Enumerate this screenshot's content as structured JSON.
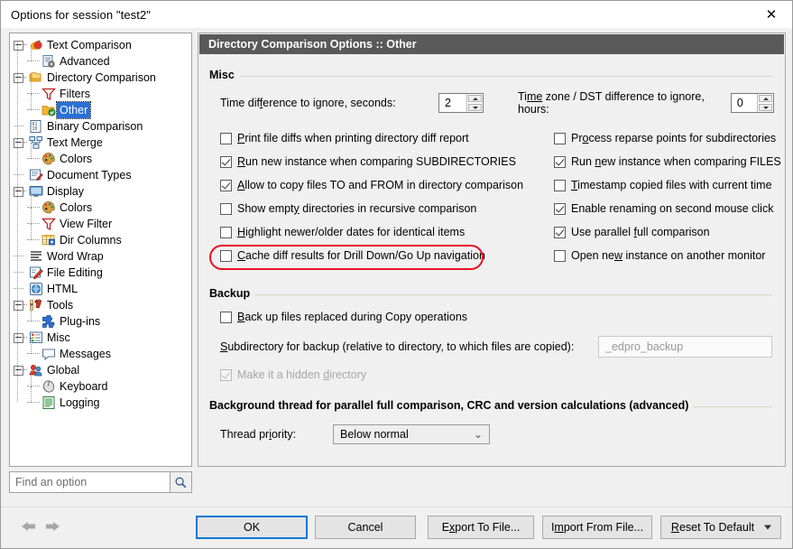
{
  "window": {
    "title": "Options for session \"test2\"",
    "close_icon": "close-icon"
  },
  "sidebar": {
    "items": [
      {
        "label": "Text Comparison",
        "level": 0,
        "icon": "apples-icon",
        "expander": "minus",
        "selected": false
      },
      {
        "label": "Advanced",
        "level": 1,
        "icon": "advanced-doc-icon",
        "expander": "none",
        "selected": false
      },
      {
        "label": "Directory Comparison",
        "level": 0,
        "icon": "folders-icon",
        "expander": "minus",
        "selected": false
      },
      {
        "label": "Filters",
        "level": 1,
        "icon": "funnel-icon",
        "expander": "none",
        "selected": false
      },
      {
        "label": "Other",
        "level": 1,
        "icon": "folder-check-icon",
        "expander": "none",
        "selected": true
      },
      {
        "label": "Binary Comparison",
        "level": 0,
        "icon": "binary-icon",
        "expander": "none",
        "selected": false
      },
      {
        "label": "Text Merge",
        "level": 0,
        "icon": "merge-icon",
        "expander": "minus",
        "selected": false
      },
      {
        "label": "Colors",
        "level": 1,
        "icon": "palette-icon",
        "expander": "none",
        "selected": false
      },
      {
        "label": "Document Types",
        "level": 0,
        "icon": "document-types-icon",
        "expander": "none",
        "selected": false
      },
      {
        "label": "Display",
        "level": 0,
        "icon": "monitor-icon",
        "expander": "minus",
        "selected": false
      },
      {
        "label": "Colors",
        "level": 1,
        "icon": "palette-icon",
        "expander": "none",
        "selected": false
      },
      {
        "label": "View Filter",
        "level": 1,
        "icon": "funnel-icon",
        "expander": "none",
        "selected": false
      },
      {
        "label": "Dir Columns",
        "level": 1,
        "icon": "columns-icon",
        "expander": "none",
        "selected": false
      },
      {
        "label": "Word Wrap",
        "level": 0,
        "icon": "wordwrap-icon",
        "expander": "none",
        "selected": false
      },
      {
        "label": "File Editing",
        "level": 0,
        "icon": "pencil-icon",
        "expander": "none",
        "selected": false
      },
      {
        "label": "HTML",
        "level": 0,
        "icon": "globe-icon",
        "expander": "none",
        "selected": false
      },
      {
        "label": "Tools",
        "level": 0,
        "icon": "hammer-icon",
        "expander": "minus",
        "selected": false
      },
      {
        "label": "Plug-ins",
        "level": 1,
        "icon": "puzzle-icon",
        "expander": "none",
        "selected": false
      },
      {
        "label": "Misc",
        "level": 0,
        "icon": "misc-icon",
        "expander": "minus",
        "selected": false
      },
      {
        "label": "Messages",
        "level": 1,
        "icon": "speech-icon",
        "expander": "none",
        "selected": false
      },
      {
        "label": "Global",
        "level": 0,
        "icon": "people-icon",
        "expander": "minus",
        "selected": false
      },
      {
        "label": "Keyboard",
        "level": 1,
        "icon": "mouse-icon",
        "expander": "none",
        "selected": false
      },
      {
        "label": "Logging",
        "level": 1,
        "icon": "log-icon",
        "expander": "none",
        "selected": false
      }
    ]
  },
  "search": {
    "placeholder": "Find an option",
    "value": "",
    "icon": "magnifier-icon"
  },
  "panel": {
    "header": "Directory Comparison Options :: Other",
    "misc": {
      "group_title": "Misc",
      "time_diff_label_pre": "Time dif",
      "time_diff_label_accel": "f",
      "time_diff_label_post": "erence to ignore, seconds:",
      "time_diff_value": "2",
      "timezone_label_pre": "Ti",
      "timezone_label_accel": "me",
      "timezone_label_post": " zone / DST difference to ignore, hours:",
      "timezone_value": "0",
      "left_checkboxes": [
        {
          "label_pre": "",
          "accel": "P",
          "label_post": "rint file diffs when printing directory diff report",
          "checked": false
        },
        {
          "label_pre": "",
          "accel": "R",
          "label_post": "un new instance when comparing SUBDIRECTORIES",
          "checked": true
        },
        {
          "label_pre": "",
          "accel": "A",
          "label_post": "llow to copy files TO and FROM in directory comparison",
          "checked": true
        },
        {
          "label_pre": "Show empt",
          "accel": "y",
          "label_post": " directories in recursive comparison",
          "checked": false
        },
        {
          "label_pre": "",
          "accel": "H",
          "label_post": "ighlight newer/older dates for identical items",
          "checked": false
        },
        {
          "label_pre": "",
          "accel": "C",
          "label_post": "ache diff results for Drill Down/Go Up navigation",
          "checked": false,
          "highlighted": true
        }
      ],
      "right_checkboxes": [
        {
          "label_pre": "Pr",
          "accel": "o",
          "label_post": "cess reparse points for subdirectories",
          "checked": false
        },
        {
          "label_pre": "Run ",
          "accel": "n",
          "label_post": "ew instance when comparing FILES",
          "checked": true
        },
        {
          "label_pre": "",
          "accel": "T",
          "label_post": "imestamp copied files with current time",
          "checked": false
        },
        {
          "label_pre": "Enable renamin",
          "accel": "g",
          "label_post": " on second mouse click",
          "checked": true
        },
        {
          "label_pre": "Use parallel ",
          "accel": "f",
          "label_post": "ull comparison",
          "checked": true
        },
        {
          "label_pre": "Open ne",
          "accel": "w",
          "label_post": " instance on another monitor",
          "checked": false
        }
      ]
    },
    "backup": {
      "group_title": "Backup",
      "checkbox": {
        "label_pre": "",
        "accel": "B",
        "label_post": "ack up files replaced during Copy operations",
        "checked": false
      },
      "subdir_label_pre": "",
      "subdir_label_accel": "S",
      "subdir_label_post": "ubdirectory for backup (relative to directory, to which files are copied):",
      "subdir_value": "_edpro_backup",
      "hidden_checkbox": {
        "label_pre": "Make it a hidden ",
        "accel": "d",
        "label_post": "irectory",
        "checked": true,
        "disabled": true
      }
    },
    "background": {
      "group_title": "Background thread for parallel full comparison, CRC and version calculations (advanced)",
      "thread_label_pre": "Thread pr",
      "thread_label_accel": "i",
      "thread_label_post": "ority:",
      "thread_value": "Below normal",
      "thread_options": [
        "Below normal"
      ]
    }
  },
  "footer": {
    "back_icon": "arrow-left-icon",
    "forward_icon": "arrow-right-icon",
    "ok": "OK",
    "cancel": "Cancel",
    "export_pre": "E",
    "export_accel": "x",
    "export_post": "port To File...",
    "import_pre": "I",
    "import_accel": "m",
    "import_post": "port From File...",
    "reset_pre": "",
    "reset_accel": "R",
    "reset_post": "eset To Default",
    "reset_chevron": "chevron-down-icon"
  },
  "colors": {
    "header_bg": "#595959",
    "selection": "#2a6fd6",
    "highlight_red": "#e81123",
    "default_button_border": "#0078d7"
  }
}
